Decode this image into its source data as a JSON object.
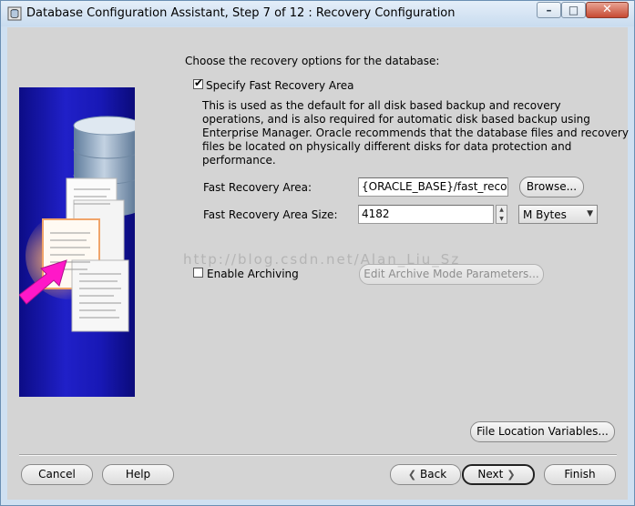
{
  "window": {
    "title": "Database Configuration Assistant, Step 7 of 12 : Recovery Configuration",
    "minimize_glyph": "–",
    "maximize_glyph": "□",
    "close_glyph": "✕"
  },
  "content": {
    "instruction": "Choose the recovery options for the database:",
    "fast_recovery": {
      "checkbox_label": "Specify Fast Recovery Area",
      "checked": true,
      "description_lines": [
        "This is used as the default for all disk based backup and recovery",
        "operations, and is also required for automatic disk based backup using",
        "Enterprise Manager. Oracle recommends that the database files and recovery",
        "files be located on physically different disks for data protection and",
        "performance."
      ],
      "area_label": "Fast Recovery Area:",
      "area_value": "{ORACLE_BASE}/fast_recover",
      "browse_label": "Browse...",
      "size_label": "Fast Recovery Area Size:",
      "size_value": "4182",
      "unit_value": "M Bytes"
    },
    "archiving": {
      "checkbox_label": "Enable Archiving",
      "checked": false,
      "edit_button_label": "Edit Archive Mode Parameters..."
    },
    "file_location_button_label": "File Location Variables..."
  },
  "footer": {
    "cancel_label": "Cancel",
    "help_label": "Help",
    "back_label": "Back",
    "next_label": "Next",
    "finish_label": "Finish"
  },
  "watermark": "http://blog.csdn.net/Alan_Liu_Sz",
  "colors": {
    "title_bar": "#cfe0f1",
    "dialog_bg": "#d4d4d4",
    "wizard_image_blue": "#1818b6",
    "close_button": "#c74a33"
  },
  "icons": {
    "title_icon": "database-window-icon",
    "wizard_image": "database-documents-illustration"
  }
}
